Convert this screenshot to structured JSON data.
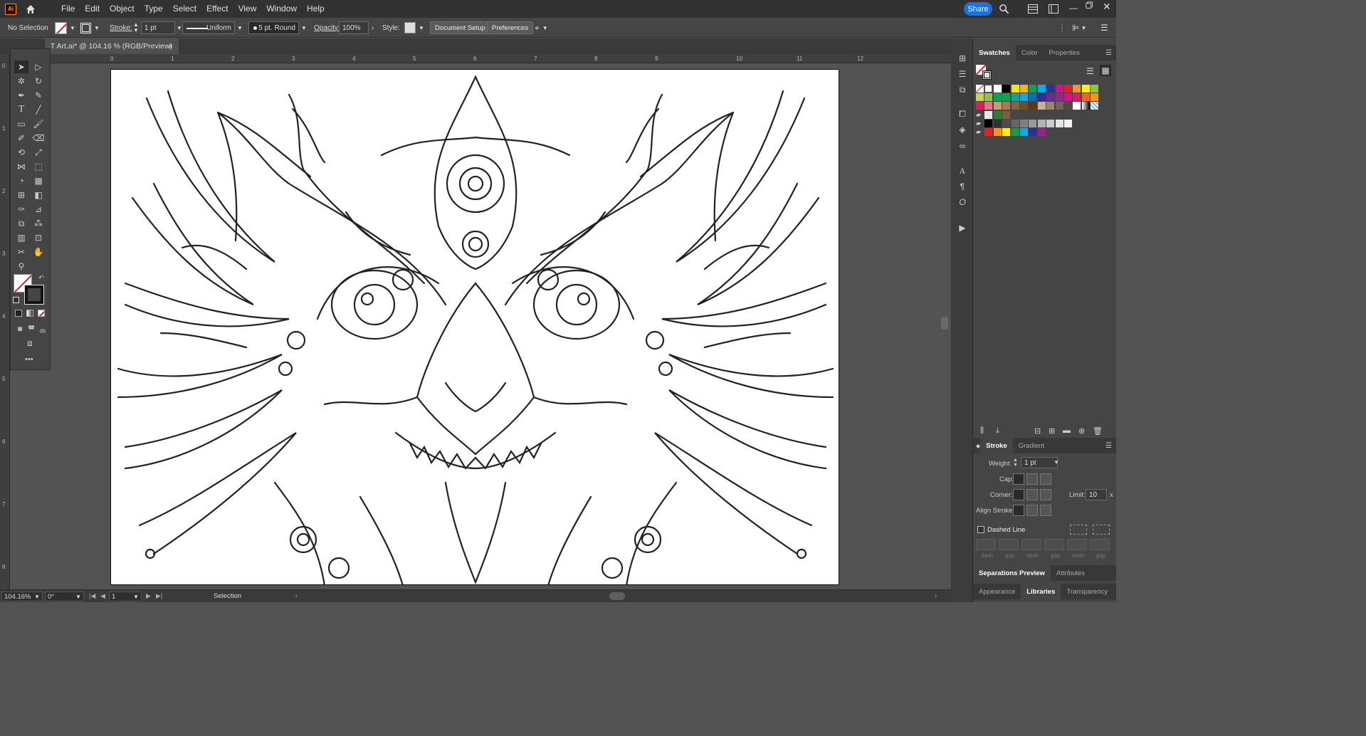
{
  "app": {
    "logo": "Ai"
  },
  "menu": [
    "File",
    "Edit",
    "Object",
    "Type",
    "Select",
    "Effect",
    "View",
    "Window",
    "Help"
  ],
  "share_label": "Share",
  "control": {
    "selection": "No Selection",
    "stroke_label": "Stroke:",
    "stroke_value": "1 pt",
    "profile": "Uniform",
    "brush": "5 pt. Round",
    "opacity_label": "Opacity:",
    "opacity_value": "100%",
    "style_label": "Style:",
    "doc_setup": "Document Setup",
    "preferences": "Preferences"
  },
  "document_tab": {
    "title": "T Art.ai* @ 104.16 % (RGB/Preview)",
    "close": "×"
  },
  "ruler_h": [
    "0",
    "1",
    "2",
    "3",
    "4",
    "5",
    "6",
    "7",
    "8",
    "9",
    "10",
    "11",
    "12"
  ],
  "ruler_v": [
    "0",
    "1",
    "2",
    "3",
    "4",
    "5",
    "6",
    "7",
    "8"
  ],
  "tools_more": "•••",
  "panels": {
    "swatches_tabs": [
      "Swatches",
      "Color",
      "Properties"
    ],
    "stroke_tabs": [
      "Stroke",
      "Gradient"
    ],
    "stroke": {
      "weight_label": "Weight:",
      "weight_value": "1 pt",
      "cap_label": "Cap:",
      "corner_label": "Corner:",
      "limit_label": "Limit:",
      "limit_value": "10",
      "limit_unit": "x",
      "align_label": "Align Stroke:",
      "dashed_label": "Dashed Line",
      "dash_labels": [
        "dash",
        "gap",
        "dash",
        "gap",
        "dash",
        "gap"
      ]
    },
    "bottom_tabs1": [
      "Separations Preview",
      "Attributes"
    ],
    "bottom_tabs2": [
      "Appearance",
      "Libraries",
      "Transparency"
    ]
  },
  "status": {
    "zoom": "104.16%",
    "rotation": "0°",
    "artboard": "1",
    "tool": "Selection"
  },
  "colors": {
    "accent": "#1473e6",
    "logo_bg": "#330000",
    "logo_fg": "#ff9a00"
  }
}
